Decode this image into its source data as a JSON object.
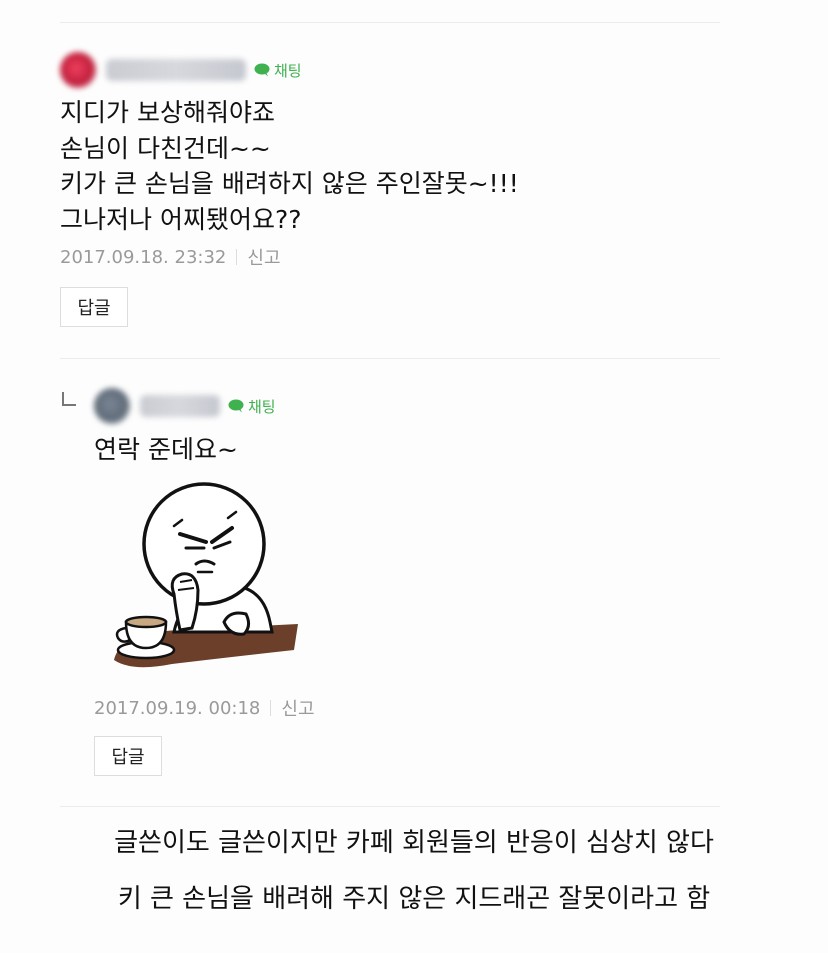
{
  "comments": [
    {
      "chat_label": "채팅",
      "lines": "지디가 보상해줘야죠\n손님이 다친건데~~\n키가 큰 손님을 배려하지 않은 주인잘못~!!!\n그나저나 어찌됐어요??",
      "timestamp": "2017.09.18. 23:32",
      "report_label": "신고",
      "reply_label": "답글"
    },
    {
      "chat_label": "채팅",
      "lines": "연락 준데요~",
      "timestamp": "2017.09.19. 00:18",
      "report_label": "신고",
      "reply_label": "답글"
    }
  ],
  "caption": {
    "line1": "글쓴이도 글쓴이지만 카페 회원들의 반응이 심상치 않다",
    "line2": "키 큰 손님을 배려해 주지 않은 지드래곤 잘못이라고 함"
  },
  "colors": {
    "chat_green": "#3fb24f",
    "meta_gray": "#9a9a9a",
    "divider": "#ececec"
  },
  "icons": {
    "chat": "speech-bubble-icon",
    "sticker": "line-moon-sticker-annoyed"
  }
}
